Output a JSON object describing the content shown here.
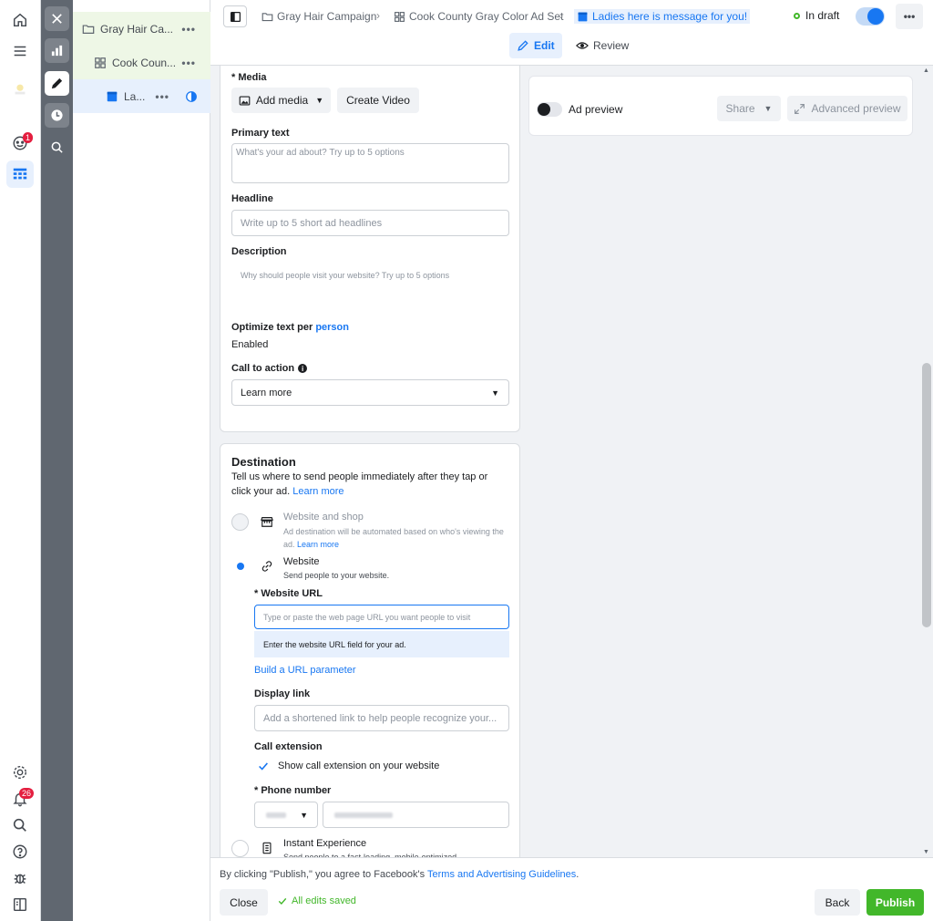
{
  "tree": {
    "campaign": "Gray Hair Ca...",
    "adset": "Cook Coun...",
    "ad": "La...",
    "dots": "•••"
  },
  "header": {
    "crumb_campaign": "Gray Hair Campaign",
    "crumb_adset": "Cook County Gray Color Ad Set",
    "crumb_ad": "Ladies here is message for you!",
    "status": "In draft",
    "more": "•••",
    "tab_edit": "Edit",
    "tab_review": "Review"
  },
  "rail": {
    "chat_badge": "1",
    "notif_badge": "26"
  },
  "editor": {
    "media_label": "* Media",
    "add_media": "Add media",
    "create_video": "Create Video",
    "primary_label": "Primary text",
    "primary_placeholder": "What's your ad about? Try up to 5 options",
    "headline_label": "Headline",
    "headline_placeholder": "Write up to 5 short ad headlines",
    "description_label": "Description",
    "description_placeholder": "Why should people visit your website? Try up to 5 options",
    "optimize_label": "Optimize text per",
    "optimize_link": "person",
    "optimize_value": "Enabled",
    "cta_label": "Call to action",
    "cta_value": "Learn more"
  },
  "destination": {
    "title": "Destination",
    "desc": "Tell us where to send people immediately after they tap or click your ad.",
    "learn_more": "Learn more",
    "shop_title": "Website and shop",
    "shop_desc": "Ad destination will be automated based on who's viewing the ad.",
    "shop_learn": "Learn more",
    "website_title": "Website",
    "website_desc": "Send people to your website.",
    "url_label": "* Website URL",
    "url_placeholder": "Type or paste the web page URL you want people to visit",
    "url_hint": "Enter the website URL field for your ad.",
    "url_param": "Build a URL parameter",
    "display_label": "Display link",
    "display_placeholder": "Add a shortened link to help people recognize your...",
    "call_label": "Call extension",
    "call_checkbox": "Show call extension on your website",
    "phone_label": "* Phone number",
    "instant_title": "Instant Experience",
    "instant_desc": "Send people to a fast-loading, mobile-optimized"
  },
  "preview": {
    "label": "Ad preview",
    "share": "Share",
    "advanced": "Advanced preview"
  },
  "footer": {
    "notice_prefix": "By clicking \"Publish,\" you agree to Facebook's",
    "notice_link": "Terms and Advertising Guidelines",
    "notice_suffix": ".",
    "close": "Close",
    "saved": "All edits saved",
    "back": "Back",
    "publish": "Publish"
  }
}
